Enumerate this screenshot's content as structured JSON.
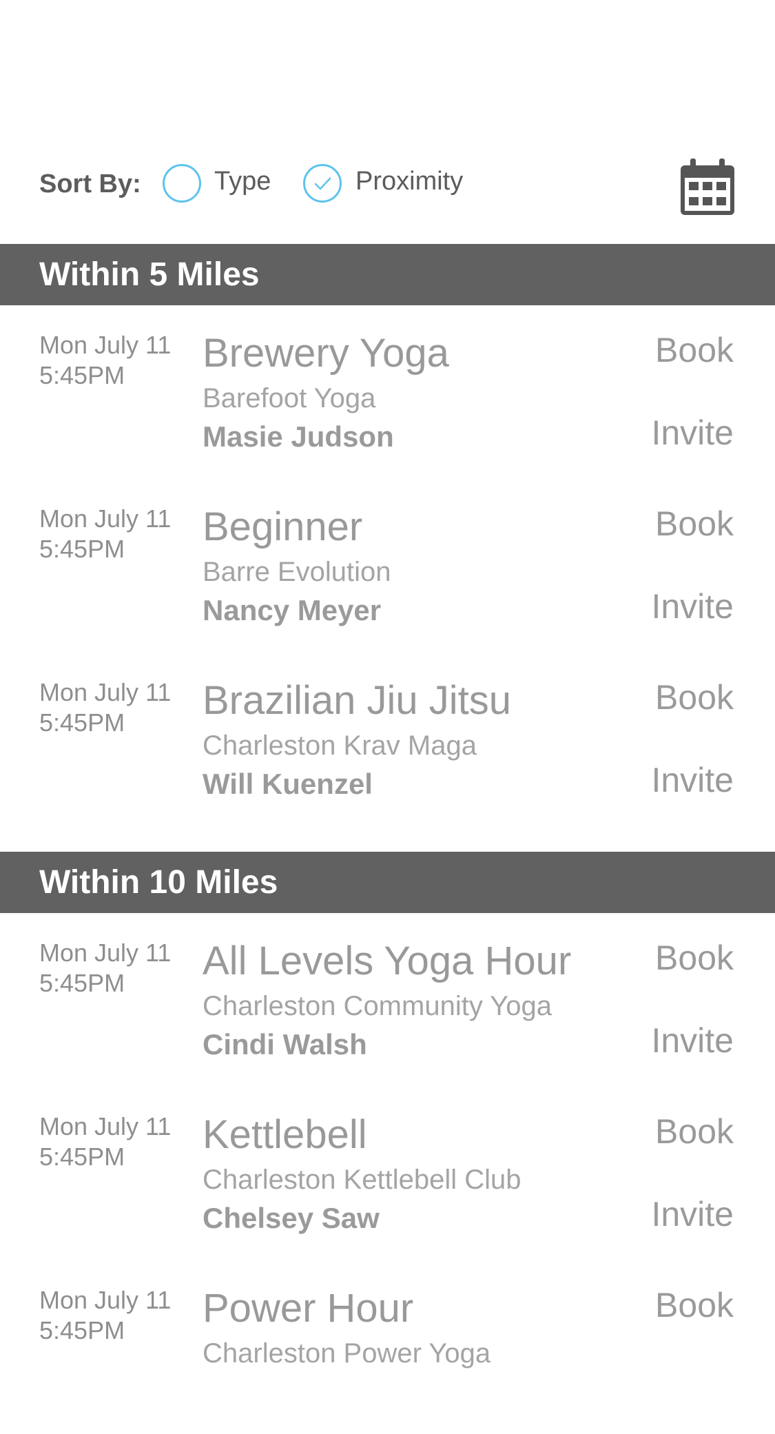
{
  "sort": {
    "label": "Sort By:",
    "options": [
      {
        "label": "Type",
        "selected": false
      },
      {
        "label": "Proximity",
        "selected": true
      }
    ],
    "accent_color": "#5ec3ec",
    "calendar_icon": "calendar-icon"
  },
  "sections": [
    {
      "title": "Within 5 Miles",
      "items": [
        {
          "date": "Mon July 11",
          "time": "5:45PM",
          "class": "Brewery Yoga",
          "studio": "Barefoot Yoga",
          "instructor": "Masie Judson",
          "book": "Book",
          "invite": "Invite"
        },
        {
          "date": "Mon July 11",
          "time": "5:45PM",
          "class": "Beginner",
          "studio": "Barre Evolution",
          "instructor": "Nancy Meyer",
          "book": "Book",
          "invite": "Invite"
        },
        {
          "date": "Mon July 11",
          "time": "5:45PM",
          "class": "Brazilian Jiu Jitsu",
          "studio": "Charleston Krav Maga",
          "instructor": "Will Kuenzel",
          "book": "Book",
          "invite": "Invite"
        }
      ]
    },
    {
      "title": "Within 10 Miles",
      "items": [
        {
          "date": "Mon July 11",
          "time": "5:45PM",
          "class": "All Levels Yoga Hour",
          "studio": "Charleston Community Yoga",
          "instructor": "Cindi Walsh",
          "book": "Book",
          "invite": "Invite"
        },
        {
          "date": "Mon July 11",
          "time": "5:45PM",
          "class": "Kettlebell",
          "studio": "Charleston Kettlebell Club",
          "instructor": "Chelsey Saw",
          "book": "Book",
          "invite": "Invite"
        },
        {
          "date": "Mon July 11",
          "time": "5:45PM",
          "class": "Power Hour",
          "studio": "Charleston Power Yoga",
          "instructor": "",
          "book": "Book",
          "invite": ""
        }
      ]
    }
  ],
  "colors": {
    "section_header_bg": "#616161",
    "text_gray": "#9a9a9a"
  }
}
